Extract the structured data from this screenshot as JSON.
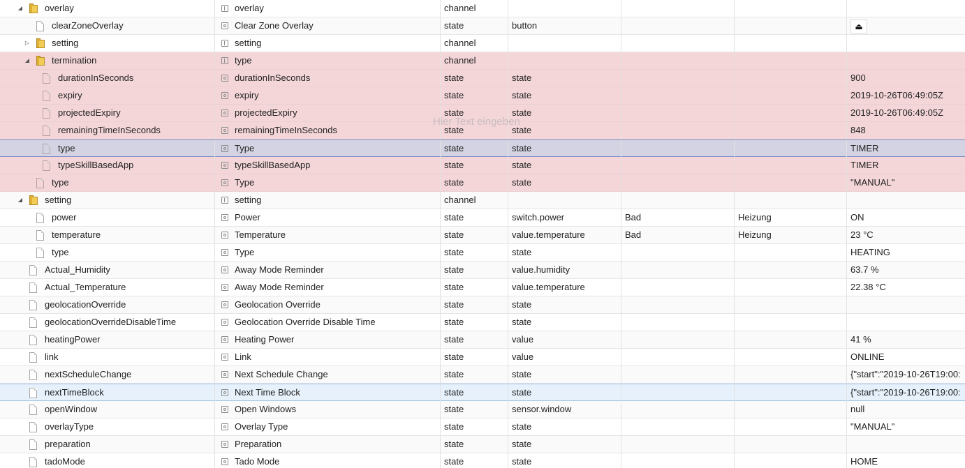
{
  "watermark": "Hier Text eingeben",
  "rows": [
    {
      "id": "overlay",
      "name": "overlay",
      "role": "channel",
      "title": "overlay",
      "type": "channel",
      "roleval": "",
      "room": "",
      "func": "",
      "value": ""
    },
    {
      "id": "clearZoneOverlay",
      "name": "Clear Zone Overlay",
      "role": "state",
      "title": "clearZoneOverlay",
      "type": "state",
      "roleval": "button",
      "room": "",
      "func": "",
      "value": "⏏"
    },
    {
      "id": "setting",
      "name": "setting",
      "role": "channel",
      "title": "setting",
      "type": "channel",
      "roleval": "",
      "room": "",
      "func": "",
      "value": ""
    },
    {
      "id": "termination",
      "name": "type",
      "role": "channel",
      "title": "termination",
      "type": "channel",
      "roleval": "",
      "room": "",
      "func": "",
      "value": ""
    },
    {
      "id": "durationInSeconds",
      "name": "durationInSeconds",
      "role": "state",
      "title": "durationInSeconds",
      "type": "state",
      "roleval": "state",
      "room": "",
      "func": "",
      "value": "900"
    },
    {
      "id": "expiry",
      "name": "expiry",
      "role": "state",
      "title": "expiry",
      "type": "state",
      "roleval": "state",
      "room": "",
      "func": "",
      "value": "2019-10-26T06:49:05Z"
    },
    {
      "id": "projectedExpiry",
      "name": "projectedExpiry",
      "role": "state",
      "title": "projectedExpiry",
      "type": "state",
      "roleval": "state",
      "room": "",
      "func": "",
      "value": "2019-10-26T06:49:05Z"
    },
    {
      "id": "remainingTimeInSeconds",
      "name": "remainingTimeInSeconds",
      "role": "state",
      "title": "remainingTimeInSeconds",
      "type": "state",
      "roleval": "state",
      "room": "",
      "func": "",
      "value": "848"
    },
    {
      "id": "type",
      "name": "Type",
      "role": "state",
      "title": "type",
      "type": "state",
      "roleval": "state",
      "room": "",
      "func": "",
      "value": "TIMER"
    },
    {
      "id": "typeSkillBasedApp",
      "name": "typeSkillBasedApp",
      "role": "state",
      "title": "typeSkillBasedApp",
      "type": "state",
      "roleval": "state",
      "room": "",
      "func": "",
      "value": "TIMER"
    },
    {
      "id": "type",
      "name": "Type",
      "role": "state",
      "title": "type",
      "type": "state",
      "roleval": "state",
      "room": "",
      "func": "",
      "value": "\"MANUAL\""
    },
    {
      "id": "setting",
      "name": "setting",
      "role": "channel",
      "title": "setting",
      "type": "channel",
      "roleval": "",
      "room": "",
      "func": "",
      "value": ""
    },
    {
      "id": "power",
      "name": "Power",
      "role": "state",
      "title": "power",
      "type": "state",
      "roleval": "switch.power",
      "room": "Bad",
      "func": "Heizung",
      "value": "ON"
    },
    {
      "id": "temperature",
      "name": "Temperature",
      "role": "state",
      "title": "temperature",
      "type": "state",
      "roleval": "value.temperature",
      "room": "Bad",
      "func": "Heizung",
      "value": "23 °C"
    },
    {
      "id": "type",
      "name": "Type",
      "role": "state",
      "title": "type",
      "type": "state",
      "roleval": "state",
      "room": "",
      "func": "",
      "value": "HEATING"
    },
    {
      "id": "Actual_Humidity",
      "name": "Away Mode Reminder",
      "role": "state",
      "title": "Actual_Humidity",
      "type": "state",
      "roleval": "value.humidity",
      "room": "",
      "func": "",
      "value": "63.7 %"
    },
    {
      "id": "Actual_Temperature",
      "name": "Away Mode Reminder",
      "role": "state",
      "title": "Actual_Temperature",
      "type": "state",
      "roleval": "value.temperature",
      "room": "",
      "func": "",
      "value": "22.38 °C"
    },
    {
      "id": "geolocationOverride",
      "name": "Geolocation Override",
      "role": "state",
      "title": "geolocationOverride",
      "type": "state",
      "roleval": "state",
      "room": "",
      "func": "",
      "value": ""
    },
    {
      "id": "geolocationOverrideDisableTime",
      "name": "Geolocation Override Disable Time",
      "role": "state",
      "title": "geolocationOverrideDisableTime",
      "type": "state",
      "roleval": "state",
      "room": "",
      "func": "",
      "value": ""
    },
    {
      "id": "heatingPower",
      "name": "Heating Power",
      "role": "state",
      "title": "heatingPower",
      "type": "state",
      "roleval": "value",
      "room": "",
      "func": "",
      "value": "41 %"
    },
    {
      "id": "link",
      "name": "Link",
      "role": "state",
      "title": "link",
      "type": "state",
      "roleval": "value",
      "room": "",
      "func": "",
      "value": "ONLINE"
    },
    {
      "id": "nextScheduleChange",
      "name": "Next Schedule Change",
      "role": "state",
      "title": "nextScheduleChange",
      "type": "state",
      "roleval": "state",
      "room": "",
      "func": "",
      "value": "{\"start\":\"2019-10-26T19:00:"
    },
    {
      "id": "nextTimeBlock",
      "name": "Next Time Block",
      "role": "state",
      "title": "nextTimeBlock",
      "type": "state",
      "roleval": "state",
      "room": "",
      "func": "",
      "value": "{\"start\":\"2019-10-26T19:00:"
    },
    {
      "id": "openWindow",
      "name": "Open Windows",
      "role": "state",
      "title": "openWindow",
      "type": "state",
      "roleval": "sensor.window",
      "room": "",
      "func": "",
      "value": "null"
    },
    {
      "id": "overlayType",
      "name": "Overlay Type",
      "role": "state",
      "title": "overlayType",
      "type": "state",
      "roleval": "state",
      "room": "",
      "func": "",
      "value": "\"MANUAL\""
    },
    {
      "id": "preparation",
      "name": "Preparation",
      "role": "state",
      "title": "preparation",
      "type": "state",
      "roleval": "state",
      "room": "",
      "func": "",
      "value": ""
    },
    {
      "id": "tadoMode",
      "name": "Tado Mode",
      "role": "state",
      "title": "tadoMode",
      "type": "state",
      "roleval": "state",
      "room": "",
      "func": "",
      "value": "HOME"
    }
  ]
}
